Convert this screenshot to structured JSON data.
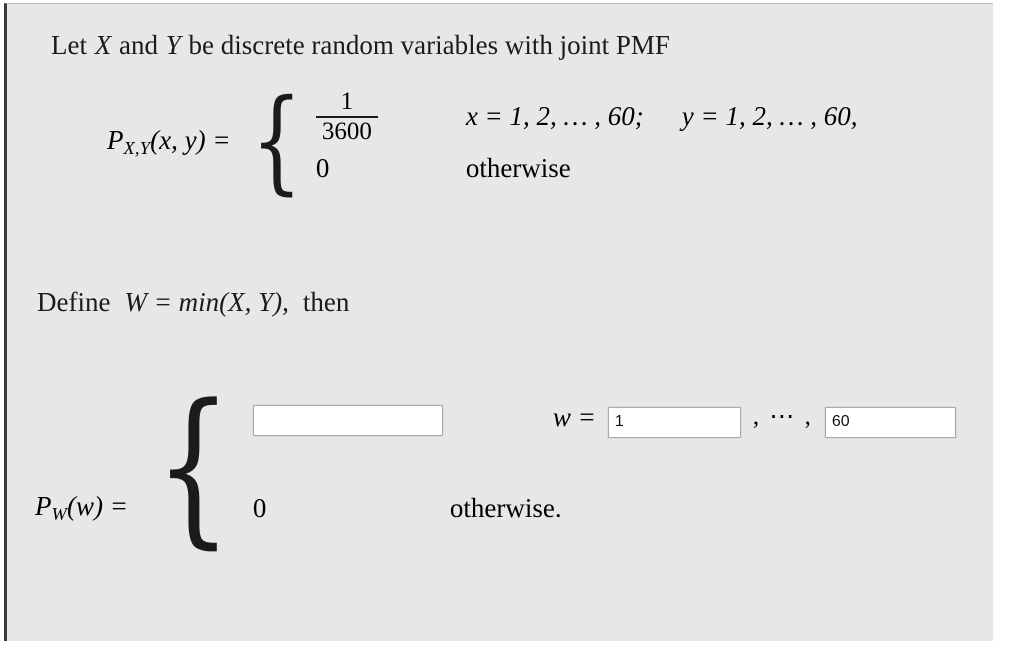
{
  "problem": {
    "intro": {
      "prefix": "Let ",
      "var_x": "X",
      "mid": " and ",
      "var_y": "Y",
      "suffix": " be discrete random variables with joint PMF"
    },
    "joint_pmf": {
      "lhs_symbol": "P",
      "lhs_subscript": "X,Y",
      "lhs_args": "(x, y) =",
      "case1_numerator": "1",
      "case1_denominator": "3600",
      "case1_condition_x": "x = 1, 2, … , 60;",
      "case1_condition_y": "y = 1, 2, … , 60,",
      "case2_value": "0",
      "case2_condition": "otherwise"
    },
    "define": {
      "label": "Define",
      "equation": "W = min(X, Y),",
      "then": "then"
    },
    "answer_pmf": {
      "lhs_symbol": "P",
      "lhs_subscript": "W",
      "lhs_args": "(w) =",
      "expression_value": "",
      "expression_placeholder": "",
      "w_label": "w =",
      "w_lower_value": "1",
      "range_separator": ", ⋯ ,",
      "w_upper_value": "60",
      "case2_value": "0",
      "case2_condition": "otherwise."
    }
  },
  "colors": {
    "panel_background": "#e7e7e7",
    "text": "#1b1b1b",
    "input_background": "#ffffff",
    "input_border": "#a8a8a8",
    "left_rail": "#3a3a3a"
  }
}
